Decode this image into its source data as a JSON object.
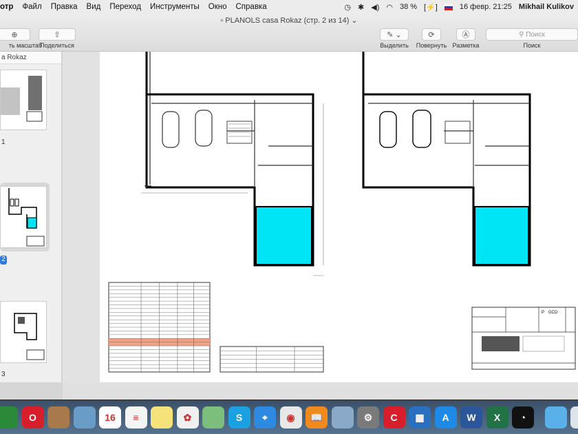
{
  "menubar": {
    "items": [
      "отр",
      "Файл",
      "Правка",
      "Вид",
      "Переход",
      "Инструменты",
      "Окно",
      "Справка"
    ],
    "status": {
      "battery": "38 %",
      "date_time": "16 февр. 21:25",
      "user": "Mikhail Kulikov",
      "icons": [
        "time-machine-icon",
        "bluetooth-icon",
        "volume-icon",
        "wifi-icon",
        "battery-icon",
        "flag-icon"
      ]
    }
  },
  "window": {
    "title": "PLANOLS casa Rokaz (стр. 2 из 14)"
  },
  "toolbar": {
    "zoom_label": "ть масштаб",
    "share_label": "Поделиться",
    "highlight_label": "Выделить",
    "rotate_label": "Повернуть",
    "markup_label": "Разметка",
    "search_placeholder": "Поиск",
    "search_label": "Поиск"
  },
  "sidebar": {
    "title": "a Rokaz",
    "pages": [
      "1",
      "2",
      "3"
    ],
    "selected_page": "2"
  },
  "document": {
    "accent_pool": "#00e5f5",
    "title_block": {
      "p": "P",
      "code": "GCD"
    }
  },
  "dock": {
    "apps": [
      {
        "name": "app-icon",
        "color": "#2a8a3a",
        "glyph": ""
      },
      {
        "name": "opera-icon",
        "color": "#d81e2a",
        "glyph": "O"
      },
      {
        "name": "notebook-icon",
        "color": "#a8794a",
        "glyph": ""
      },
      {
        "name": "preview-icon",
        "color": "#6a9cc8",
        "glyph": ""
      },
      {
        "name": "calendar-icon",
        "color": "#ffffff",
        "glyph": "16"
      },
      {
        "name": "reminders-icon",
        "color": "#f4f4f4",
        "glyph": "≡"
      },
      {
        "name": "notes-icon",
        "color": "#f6e27a",
        "glyph": ""
      },
      {
        "name": "photos-icon",
        "color": "#f0f0f0",
        "glyph": "✿"
      },
      {
        "name": "maps-icon",
        "color": "#7cbf7c",
        "glyph": ""
      },
      {
        "name": "skype-icon",
        "color": "#1ba0e2",
        "glyph": "S"
      },
      {
        "name": "safari-icon",
        "color": "#2d8ae0",
        "glyph": "⌖"
      },
      {
        "name": "chrome-icon",
        "color": "#e8e8e8",
        "glyph": "◉"
      },
      {
        "name": "ibooks-icon",
        "color": "#f08a1c",
        "glyph": "📖"
      },
      {
        "name": "image-capture-icon",
        "color": "#8aa8c8",
        "glyph": ""
      },
      {
        "name": "system-preferences-icon",
        "color": "#7a7a7a",
        "glyph": "⚙"
      },
      {
        "name": "acrobat-icon",
        "color": "#d81e2a",
        "glyph": "C"
      },
      {
        "name": "parallels-icon",
        "color": "#2a70c0",
        "glyph": "▦"
      },
      {
        "name": "app-store-icon",
        "color": "#1e8ae6",
        "glyph": "A"
      },
      {
        "name": "word-icon",
        "color": "#2b579a",
        "glyph": "W"
      },
      {
        "name": "excel-icon",
        "color": "#217346",
        "glyph": "X"
      },
      {
        "name": "speedtest-icon",
        "color": "#111111",
        "glyph": "◔"
      },
      {
        "name": "applications-folder-icon",
        "color": "#5ab0e8",
        "glyph": ""
      },
      {
        "name": "folder-icon",
        "color": "#dde4ea",
        "glyph": ""
      }
    ]
  }
}
